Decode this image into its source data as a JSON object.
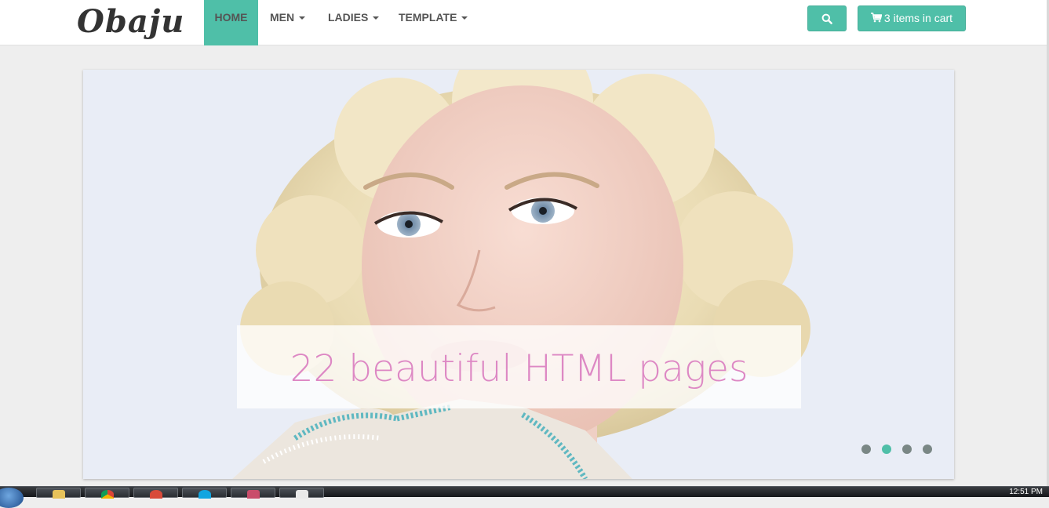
{
  "brand": {
    "logo_text": "Obaju"
  },
  "nav": {
    "items": [
      {
        "label": "Home",
        "active": true,
        "has_dropdown": false
      },
      {
        "label": "Men",
        "active": false,
        "has_dropdown": true
      },
      {
        "label": "Ladies",
        "active": false,
        "has_dropdown": true
      },
      {
        "label": "Template",
        "active": false,
        "has_dropdown": true
      }
    ]
  },
  "header_actions": {
    "search_icon": "search-icon",
    "cart_icon": "shopping-cart-icon",
    "cart_label": "3 items in cart"
  },
  "slider": {
    "caption": "22 beautiful HTML pages",
    "slide_count": 4,
    "active_slide": 2
  },
  "taskbar": {
    "clock": "12:51 PM",
    "apps": [
      "start-orb-icon",
      "file-explorer-icon",
      "chrome-icon",
      "media-player-icon",
      "skype-icon",
      "paint-icon",
      "notepad-icon"
    ]
  },
  "colors": {
    "accent": "#4fbfa8",
    "caption_text": "#dd88c4",
    "page_bg": "#eeeeee",
    "dot_inactive": "#7a8785"
  }
}
